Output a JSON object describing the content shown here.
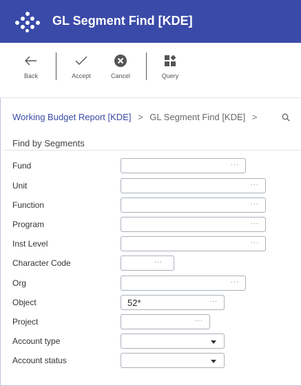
{
  "window": {
    "title": "GL Segment Find [KDE]"
  },
  "toolbar": {
    "back_label": "Back",
    "accept_label": "Accept",
    "cancel_label": "Cancel",
    "query_label": "Query"
  },
  "breadcrumb": {
    "items": [
      "Working Budget Report [KDE]",
      "GL Segment Find [KDE]"
    ],
    "separator": ">"
  },
  "section": {
    "title": "Find by Segments"
  },
  "form": {
    "fields": [
      {
        "label": "Fund",
        "value": "",
        "kind": "lookup"
      },
      {
        "label": "Unit",
        "value": "",
        "kind": "lookup"
      },
      {
        "label": "Function",
        "value": "",
        "kind": "lookup"
      },
      {
        "label": "Program",
        "value": "",
        "kind": "lookup"
      },
      {
        "label": "Inst Level",
        "value": "",
        "kind": "lookup"
      },
      {
        "label": "Character Code",
        "value": "",
        "kind": "lookup"
      },
      {
        "label": "Org",
        "value": "",
        "kind": "lookup"
      },
      {
        "label": "Object",
        "value": "52*",
        "kind": "lookup"
      },
      {
        "label": "Project",
        "value": "",
        "kind": "lookup"
      },
      {
        "label": "Account type",
        "value": "",
        "kind": "select"
      },
      {
        "label": "Account status",
        "value": "",
        "kind": "select"
      }
    ],
    "lookup_glyph": "···"
  },
  "colors": {
    "header_bg": "#3a4aa8",
    "link": "#3a4aa8",
    "accent": "#3a4aa8"
  },
  "icons": {
    "logo": "dots-logo-icon",
    "back": "arrow-left-icon",
    "accept": "checkmark-icon",
    "cancel": "x-circle-icon",
    "query": "query-grid-icon",
    "search": "search-icon"
  }
}
